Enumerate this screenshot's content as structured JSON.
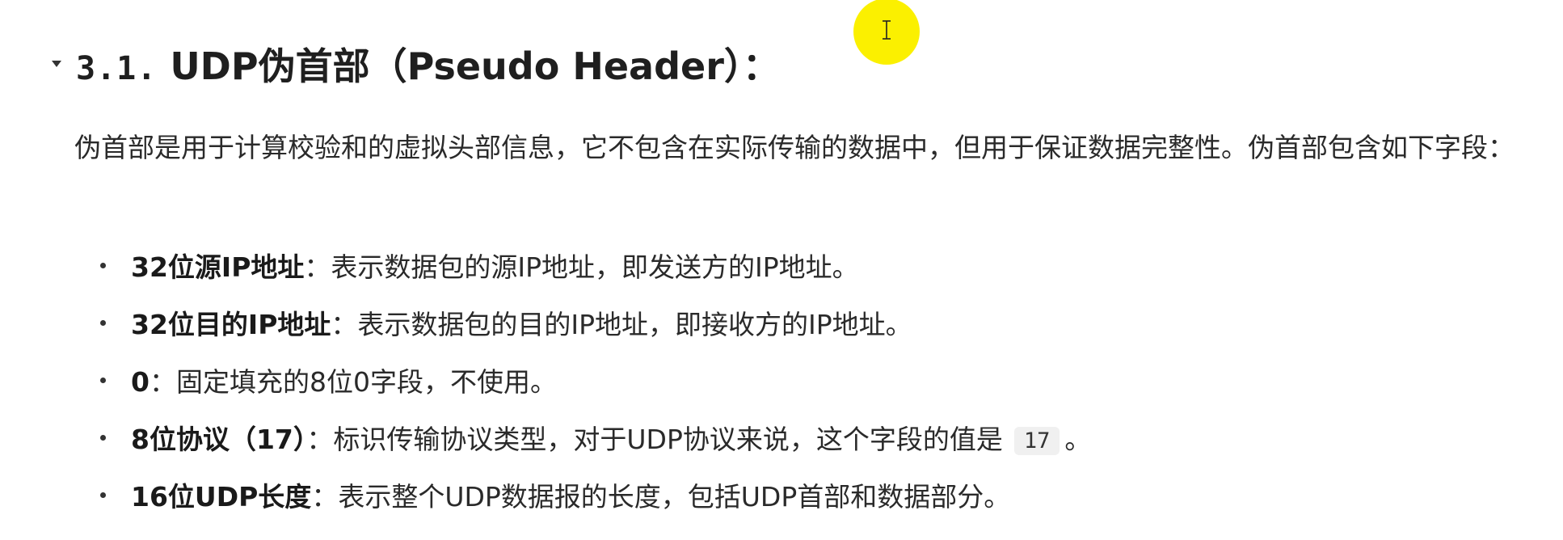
{
  "section": {
    "number": "3.1.",
    "title": "UDP伪首部（Pseudo Header）："
  },
  "intro": "伪首部是用于计算校验和的虚拟头部信息，它不包含在实际传输的数据中，但用于保证数据完整性。伪首部包含如下字段：",
  "fields": [
    {
      "term": "32位源IP地址",
      "sep": "：",
      "desc": "表示数据包的源IP地址，即发送方的IP地址。"
    },
    {
      "term": "32位目的IP地址",
      "sep": "：",
      "desc": "表示数据包的目的IP地址，即接收方的IP地址。"
    },
    {
      "term": "0",
      "sep": "：",
      "desc": "固定填充的8位0字段，不使用。"
    },
    {
      "term": "8位协议（17）",
      "sep": "：",
      "desc": "标识传输协议类型，对于UDP协议来说，这个字段的值是",
      "code": "17",
      "after": "。"
    },
    {
      "term": "16位UDP长度",
      "sep": "：",
      "desc": "表示整个UDP数据报的长度，包括UDP首部和数据部分。"
    }
  ],
  "icons": {
    "toggle": "caret-down-icon",
    "cursor": "text-cursor-icon"
  },
  "colors": {
    "cursor_highlight": "#fbf000",
    "code_background": "#f0f0f0"
  }
}
